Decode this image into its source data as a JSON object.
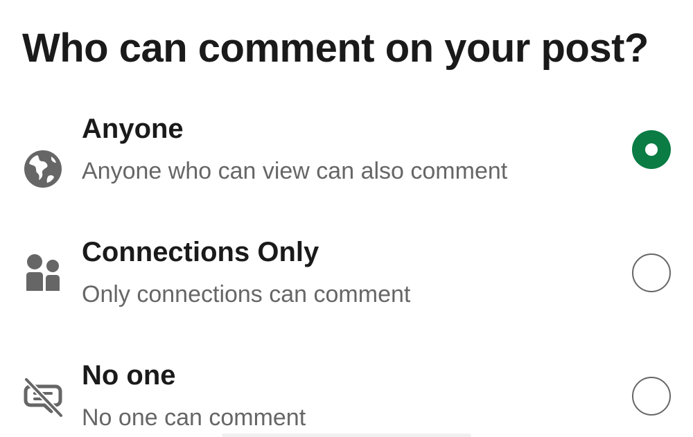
{
  "header": {
    "title": "Who can comment on your post?"
  },
  "options": [
    {
      "label": "Anyone",
      "description": "Anyone who can view can also comment",
      "icon": "globe-icon",
      "selected": true
    },
    {
      "label": "Connections Only",
      "description": "Only connections can comment",
      "icon": "people-icon",
      "selected": false
    },
    {
      "label": "No one",
      "description": "No one can comment",
      "icon": "comment-off-icon",
      "selected": false
    }
  ],
  "colors": {
    "accent": "#0a7c44",
    "icon": "#666666",
    "text_primary": "#1a1a1a",
    "text_secondary": "#666666"
  }
}
